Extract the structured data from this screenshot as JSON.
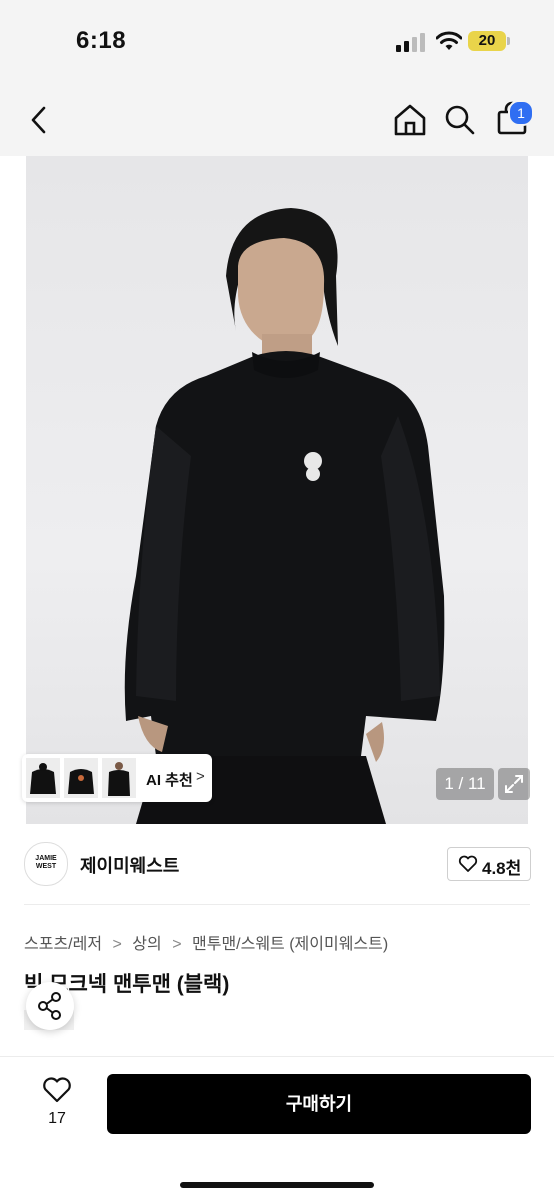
{
  "status_bar": {
    "time": "6:18",
    "battery": "20"
  },
  "header": {
    "cart_badge": "1"
  },
  "gallery": {
    "counter": "1 / 11",
    "ai_label": "AI 추천",
    "ai_chevron": ">"
  },
  "brand": {
    "logo_text_1": "JAMIE",
    "logo_text_2": "WEST",
    "name": "제이미웨스트",
    "likes": "4.8천"
  },
  "breadcrumb": [
    "스포츠/레저",
    "상의",
    "맨투맨/스웨트 (제이미웨스트)"
  ],
  "breadcrumb_sep": ">",
  "product": {
    "title": "빅 모크넥 맨투맨 (블랙)"
  },
  "bottom_bar": {
    "wish_count": "17",
    "buy_label": "구매하기"
  },
  "colors": {
    "badge": "#2f6ef2",
    "buy_button": "#000000",
    "battery": "#e9d44a"
  },
  "icons": [
    "back-icon",
    "home-icon",
    "search-icon",
    "bag-icon",
    "expand-icon",
    "heart-icon",
    "share-icon"
  ]
}
